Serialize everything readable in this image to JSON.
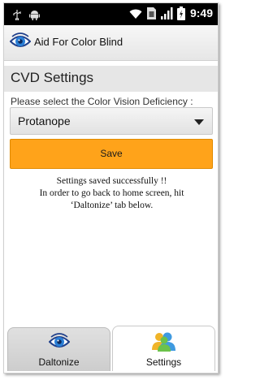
{
  "status_bar": {
    "time": "9:49",
    "icons": [
      "usb-icon",
      "android-debug-icon",
      "wifi-icon",
      "sim-icon",
      "signal-icon",
      "battery-icon"
    ]
  },
  "app": {
    "title": "Aid For Color Blind",
    "logo_icon": "eye-logo-icon"
  },
  "settings": {
    "header": "CVD Settings",
    "prompt": "Please select the Color Vision Deficiency :",
    "selected_deficiency": "Protanope",
    "save_label": "Save"
  },
  "message": {
    "line1": "Settings saved successfully !!",
    "line2": "In order to go back to home screen, hit",
    "line3": "‘Daltonize’ tab below."
  },
  "tabs": [
    {
      "label": "Daltonize",
      "icon": "eye-icon",
      "selected": false
    },
    {
      "label": "Settings",
      "icon": "users-icon",
      "selected": true
    }
  ],
  "colors": {
    "save_button": "#ffa31a",
    "status_bar": "#000000"
  }
}
